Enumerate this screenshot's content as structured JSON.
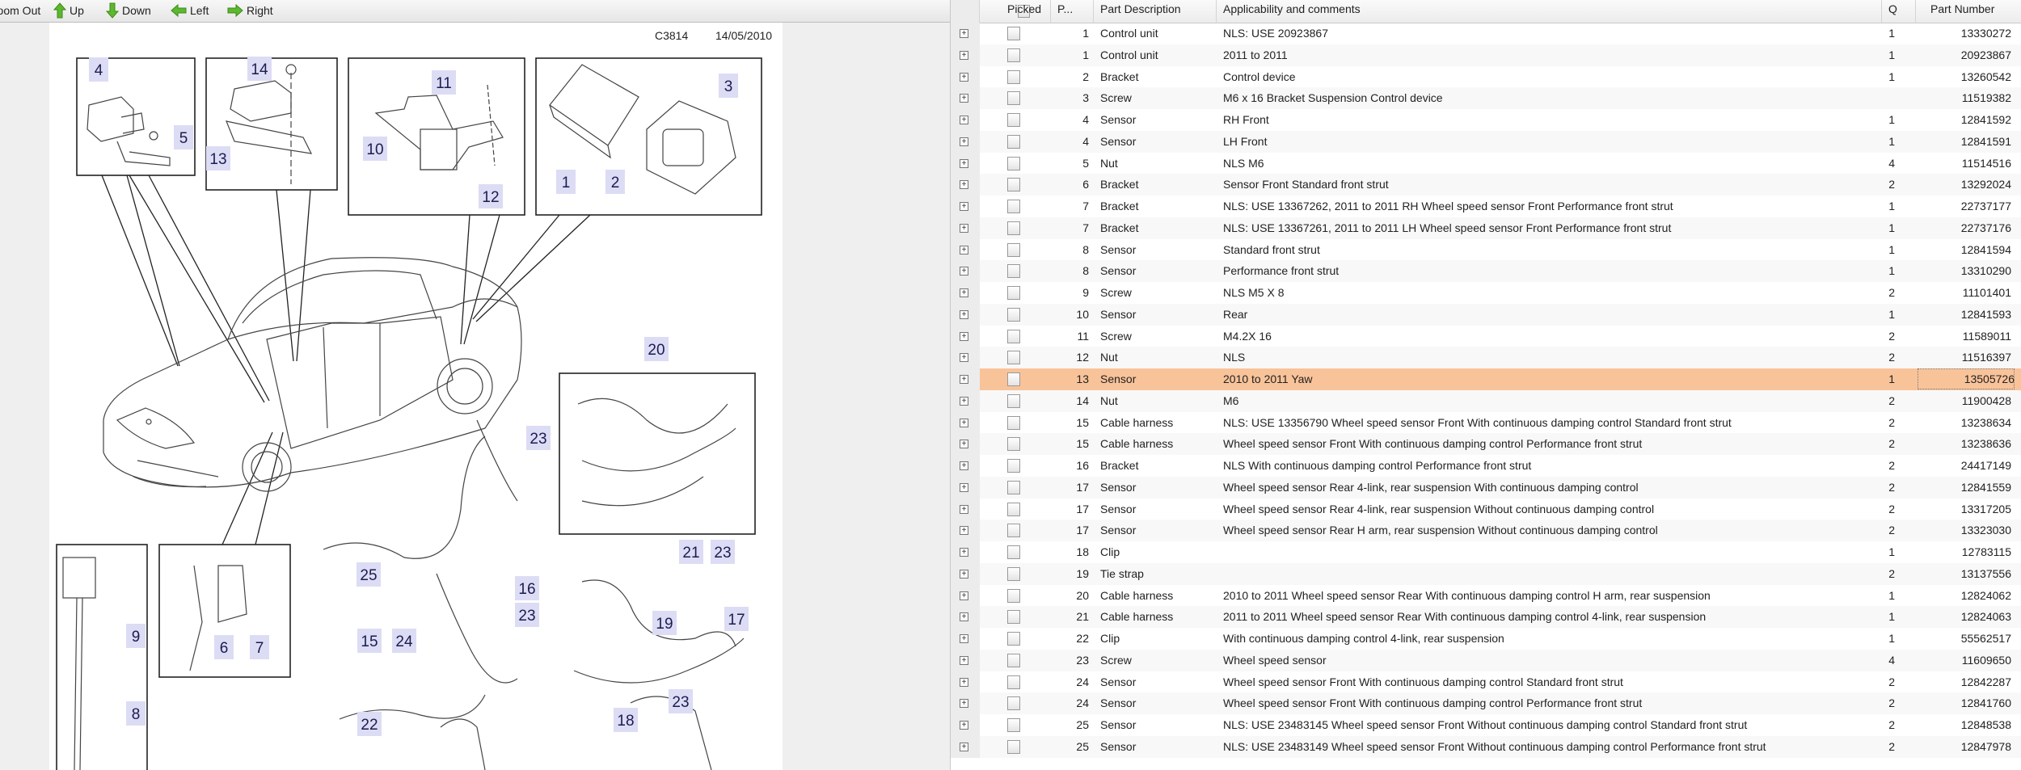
{
  "toolbar": {
    "zoom_out": "Zoom Out",
    "up": "Up",
    "down": "Down",
    "left": "Left",
    "right": "Right",
    "arrow_color": "#5cb82e"
  },
  "diagram": {
    "code": "C3814",
    "date": "14/05/2010",
    "callouts": [
      "4",
      "14",
      "11",
      "3",
      "5",
      "13",
      "10",
      "1",
      "2",
      "12",
      "20",
      "23",
      "25",
      "16",
      "23",
      "21",
      "23",
      "19",
      "17",
      "9",
      "6",
      "7",
      "15",
      "24",
      "8",
      "22",
      "23",
      "18"
    ],
    "callout_bg": "#dcdcf5",
    "callout_text": "#1c1c50"
  },
  "table": {
    "headers": {
      "picked": "Picked",
      "pos": "P...",
      "description": "Part Description",
      "applicability": "Applicability and comments",
      "qty": "Q",
      "part_number": "Part Number"
    },
    "selected_color": "#f9c39a",
    "rows": [
      {
        "pos": "1",
        "desc": "Control unit",
        "app": "NLS: USE 20923867",
        "q": "1",
        "pn": "13330272"
      },
      {
        "pos": "1",
        "desc": "Control unit",
        "app": "2011 to 2011",
        "q": "1",
        "pn": "20923867"
      },
      {
        "pos": "2",
        "desc": "Bracket",
        "app": "Control device",
        "q": "1",
        "pn": "13260542"
      },
      {
        "pos": "3",
        "desc": "Screw",
        "app": "M6 x 16 Bracket Suspension Control device",
        "q": "",
        "pn": "11519382"
      },
      {
        "pos": "4",
        "desc": "Sensor",
        "app": "RH Front",
        "q": "1",
        "pn": "12841592"
      },
      {
        "pos": "4",
        "desc": "Sensor",
        "app": "LH Front",
        "q": "1",
        "pn": "12841591"
      },
      {
        "pos": "5",
        "desc": "Nut",
        "app": "NLS M6",
        "q": "4",
        "pn": "11514516"
      },
      {
        "pos": "6",
        "desc": "Bracket",
        "app": "Sensor Front Standard front strut",
        "q": "2",
        "pn": "13292024"
      },
      {
        "pos": "7",
        "desc": "Bracket",
        "app": "NLS: USE 13367262, 2011 to 2011 RH Wheel speed sensor Front Performance front strut",
        "q": "1",
        "pn": "22737177"
      },
      {
        "pos": "7",
        "desc": "Bracket",
        "app": "NLS: USE 13367261, 2011 to 2011 LH Wheel speed sensor Front Performance front strut",
        "q": "1",
        "pn": "22737176"
      },
      {
        "pos": "8",
        "desc": "Sensor",
        "app": "Standard front strut",
        "q": "1",
        "pn": "12841594"
      },
      {
        "pos": "8",
        "desc": "Sensor",
        "app": "Performance front strut",
        "q": "1",
        "pn": "13310290"
      },
      {
        "pos": "9",
        "desc": "Screw",
        "app": "NLS M5 X 8",
        "q": "2",
        "pn": "11101401"
      },
      {
        "pos": "10",
        "desc": "Sensor",
        "app": "Rear",
        "q": "1",
        "pn": "12841593"
      },
      {
        "pos": "11",
        "desc": "Screw",
        "app": "M4.2X 16",
        "q": "2",
        "pn": "11589011"
      },
      {
        "pos": "12",
        "desc": "Nut",
        "app": "NLS",
        "q": "2",
        "pn": "11516397"
      },
      {
        "pos": "13",
        "desc": "Sensor",
        "app": "2010 to 2011 Yaw",
        "q": "1",
        "pn": "13505726",
        "selected": true
      },
      {
        "pos": "14",
        "desc": "Nut",
        "app": "M6",
        "q": "2",
        "pn": "11900428"
      },
      {
        "pos": "15",
        "desc": "Cable harness",
        "app": "NLS: USE 13356790 Wheel speed sensor Front With continuous damping control Standard front strut",
        "q": "2",
        "pn": "13238634"
      },
      {
        "pos": "15",
        "desc": "Cable harness",
        "app": "Wheel speed sensor Front With continuous damping control Performance front strut",
        "q": "2",
        "pn": "13238636"
      },
      {
        "pos": "16",
        "desc": "Bracket",
        "app": "NLS With continuous damping control Performance front strut",
        "q": "2",
        "pn": "24417149"
      },
      {
        "pos": "17",
        "desc": "Sensor",
        "app": "Wheel speed sensor Rear 4-link, rear suspension With continuous damping control",
        "q": "2",
        "pn": "12841559"
      },
      {
        "pos": "17",
        "desc": "Sensor",
        "app": "Wheel speed sensor Rear 4-link, rear suspension Without continuous damping control",
        "q": "2",
        "pn": "13317205"
      },
      {
        "pos": "17",
        "desc": "Sensor",
        "app": "Wheel speed sensor Rear H arm, rear suspension Without continuous damping control",
        "q": "2",
        "pn": "13323030"
      },
      {
        "pos": "18",
        "desc": "Clip",
        "app": "",
        "q": "1",
        "pn": "12783115"
      },
      {
        "pos": "19",
        "desc": "Tie strap",
        "app": "",
        "q": "2",
        "pn": "13137556"
      },
      {
        "pos": "20",
        "desc": "Cable harness",
        "app": "2010 to 2011 Wheel speed sensor Rear With continuous damping control H arm, rear suspension",
        "q": "1",
        "pn": "12824062"
      },
      {
        "pos": "21",
        "desc": "Cable harness",
        "app": "2011 to 2011 Wheel speed sensor Rear With continuous damping control 4-link, rear suspension",
        "q": "1",
        "pn": "12824063"
      },
      {
        "pos": "22",
        "desc": "Clip",
        "app": "With continuous damping control 4-link, rear suspension",
        "q": "1",
        "pn": "55562517"
      },
      {
        "pos": "23",
        "desc": "Screw",
        "app": "Wheel speed sensor",
        "q": "4",
        "pn": "11609650"
      },
      {
        "pos": "24",
        "desc": "Sensor",
        "app": "Wheel speed sensor Front With continuous damping control Standard front strut",
        "q": "2",
        "pn": "12842287"
      },
      {
        "pos": "24",
        "desc": "Sensor",
        "app": "Wheel speed sensor Front With continuous damping control Performance front strut",
        "q": "2",
        "pn": "12841760"
      },
      {
        "pos": "25",
        "desc": "Sensor",
        "app": "NLS: USE 23483145 Wheel speed sensor Front Without continuous damping control Standard front strut",
        "q": "2",
        "pn": "12848538"
      },
      {
        "pos": "25",
        "desc": "Sensor",
        "app": "NLS: USE 23483149 Wheel speed sensor Front Without continuous damping control Performance front strut",
        "q": "2",
        "pn": "12847978"
      }
    ]
  }
}
